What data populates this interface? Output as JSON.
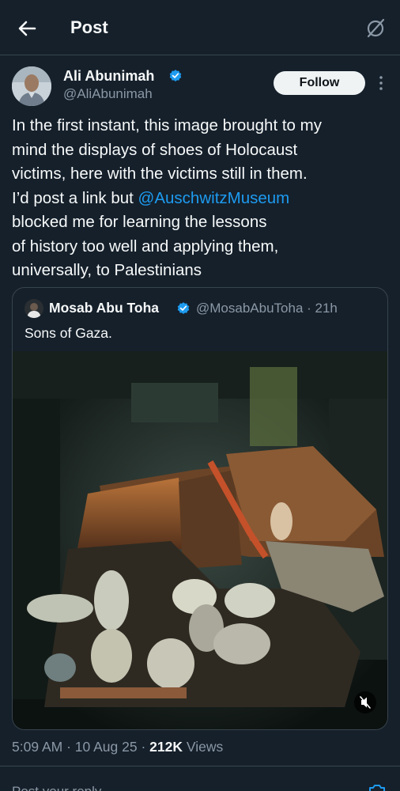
{
  "header": {
    "title": "Post",
    "back_icon": "arrow-left-icon",
    "grok_icon": "grok-slash-circle-icon"
  },
  "author": {
    "name": "Ali Abunimah",
    "handle": "@AliAbunimah",
    "verified": true,
    "follow_label": "Follow"
  },
  "post": {
    "lines": [
      "In the first instant, this image brought to my",
      "mind the displays of shoes of Holocaust",
      "victims, here with the victims still in them.",
      "I’d post a link but ",
      "blocked me for learning the lessons",
      "of history too well and applying them,",
      "universally, to Palestinians"
    ],
    "mention": "@AuschwitzMuseum"
  },
  "quoted": {
    "name": "Mosab Abu Toha",
    "handle": "@MosabAbuToha · 21h",
    "text": "Sons of Gaza.",
    "media_icon": "mute-icon"
  },
  "meta": {
    "time": "5:09 AM · 10 Aug 25 · ",
    "views_count": "212K",
    "views_label": " Views"
  },
  "reply": {
    "placeholder": "Post your reply"
  },
  "colors": {
    "background": "#15202b",
    "accent": "#1d9bf0",
    "border": "#38444d",
    "muted": "#8b98a5"
  }
}
